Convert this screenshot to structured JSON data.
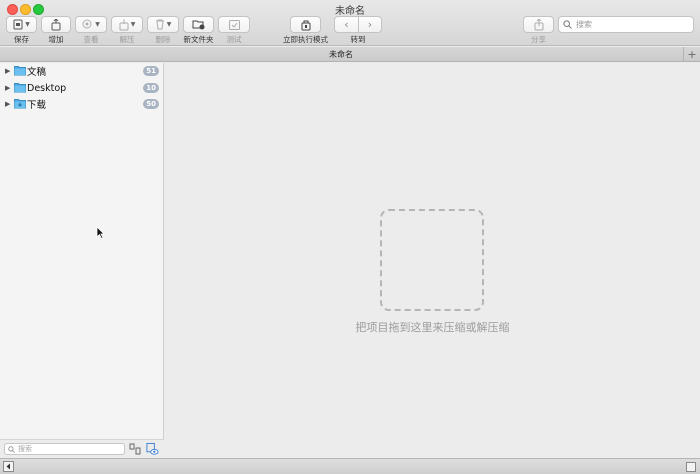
{
  "window": {
    "title": "未命名"
  },
  "toolbar": {
    "save": "保存",
    "add": "增加",
    "view": "查看",
    "extract": "解压",
    "delete": "删除",
    "new_folder": "新文件夹",
    "test": "测试",
    "instant_mode": "立即执行模式",
    "goto": "转到",
    "share": "分享",
    "search_placeholder": "搜索"
  },
  "tab": {
    "title": "未命名"
  },
  "sidebar": {
    "items": [
      {
        "label": "文稿",
        "count": "51",
        "icon": "folder-icon"
      },
      {
        "label": "Desktop",
        "count": "10",
        "icon": "folder-icon"
      },
      {
        "label": "下载",
        "count": "50",
        "icon": "folder-icon"
      }
    ],
    "search_placeholder": "搜索"
  },
  "main": {
    "drop_hint": "把项目拖到这里来压缩或解压缩"
  },
  "colors": {
    "accent": "#4aa7e0",
    "badge": "#a9b4c2",
    "close": "#fc5f57",
    "minimize": "#fdbc2e",
    "maximize": "#28c840"
  }
}
